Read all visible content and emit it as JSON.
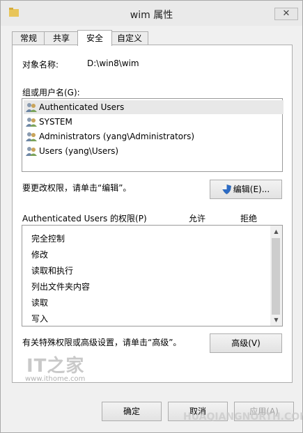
{
  "window": {
    "title": "wim 属性",
    "close_glyph": "✕"
  },
  "tabs": [
    {
      "label": "常规"
    },
    {
      "label": "共享"
    },
    {
      "label": "安全",
      "active": true
    },
    {
      "label": "自定义"
    }
  ],
  "object": {
    "label": "对象名称:",
    "value": "D:\\win8\\wim"
  },
  "users": {
    "label": "组或用户名(G):",
    "items": [
      {
        "name": "Authenticated Users",
        "selected": true
      },
      {
        "name": "SYSTEM"
      },
      {
        "name": "Administrators (yang\\Administrators)"
      },
      {
        "name": "Users (yang\\Users)"
      }
    ]
  },
  "edit": {
    "hint": "要更改权限，请单击“编辑”。",
    "button": "编辑(E)..."
  },
  "permissions": {
    "title": "Authenticated Users 的权限(P)",
    "allow": "允许",
    "deny": "拒绝",
    "items": [
      "完全控制",
      "修改",
      "读取和执行",
      "列出文件夹内容",
      "读取",
      "写入"
    ]
  },
  "advanced": {
    "hint": "有关特殊权限或高级设置，请单击“高级”。",
    "button": "高级(V)"
  },
  "footer": {
    "ok": "确定",
    "cancel": "取消",
    "apply": "应用(A)"
  },
  "watermarks": {
    "ithome_logo": "IT之家",
    "ithome_url": "www.ithome.com",
    "hqn": "HUAQIANGNORTH.COM"
  },
  "colors": {
    "panel_bg": "#ffffff",
    "window_bg": "#f0f0f0",
    "selected_row": "#e8e8e8",
    "button_border": "#adadad"
  }
}
